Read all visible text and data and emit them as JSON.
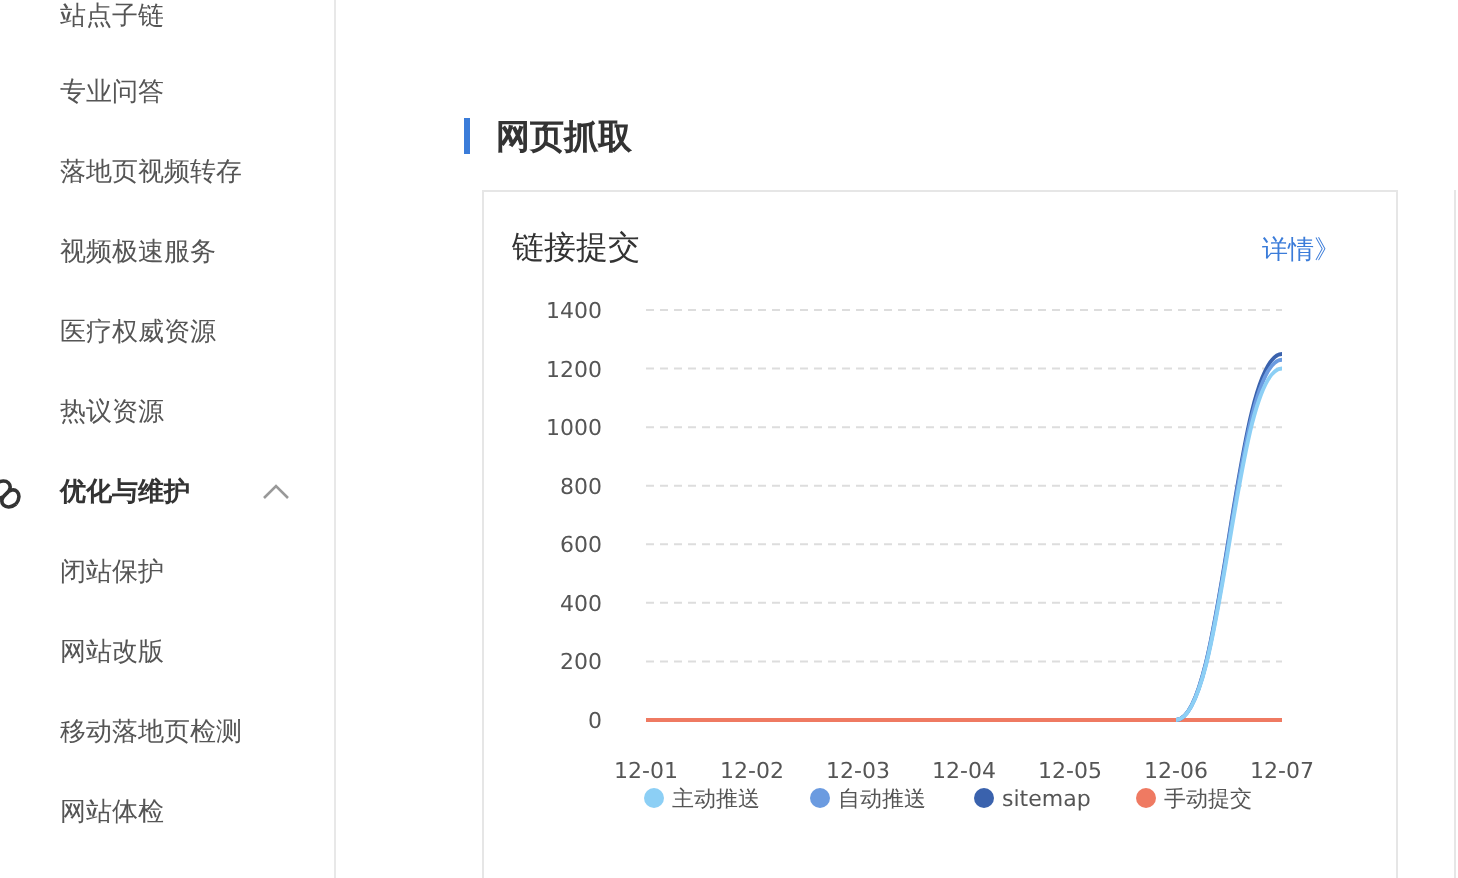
{
  "sidebar": {
    "items": [
      {
        "kind": "item",
        "label": "站点子链"
      },
      {
        "kind": "item",
        "label": "专业问答"
      },
      {
        "kind": "item",
        "label": "落地页视频转存"
      },
      {
        "kind": "item",
        "label": "视频极速服务"
      },
      {
        "kind": "item",
        "label": "医疗权威资源"
      },
      {
        "kind": "item",
        "label": "热议资源"
      },
      {
        "kind": "group",
        "label": "优化与维护",
        "expanded": true
      },
      {
        "kind": "item",
        "label": "闭站保护"
      },
      {
        "kind": "item",
        "label": "网站改版"
      },
      {
        "kind": "item",
        "label": "移动落地页检测"
      },
      {
        "kind": "item",
        "label": "网站体检"
      }
    ]
  },
  "section": {
    "title": "网页抓取"
  },
  "card": {
    "title": "链接提交",
    "link": "详情》",
    "chart_data": {
      "type": "line",
      "grid": true,
      "legend": "bottom",
      "categories": [
        "12-01",
        "12-02",
        "12-03",
        "12-04",
        "12-05",
        "12-06",
        "12-07"
      ],
      "ylim": [
        0,
        1400
      ],
      "yticks": [
        0,
        200,
        400,
        600,
        800,
        1000,
        1200,
        1400
      ],
      "series": [
        {
          "name": "主动推送",
          "color": "#8ccff5",
          "values": [
            null,
            null,
            null,
            null,
            null,
            0,
            1200
          ]
        },
        {
          "name": "自动推送",
          "color": "#6b9be0",
          "values": [
            null,
            null,
            null,
            null,
            null,
            0,
            1230
          ]
        },
        {
          "name": "sitemap",
          "color": "#3a62ad",
          "values": [
            null,
            null,
            null,
            null,
            null,
            0,
            1250
          ]
        },
        {
          "name": "手动提交",
          "color": "#ef7a62",
          "values": [
            0,
            0,
            0,
            0,
            0,
            0,
            0
          ]
        }
      ]
    }
  }
}
